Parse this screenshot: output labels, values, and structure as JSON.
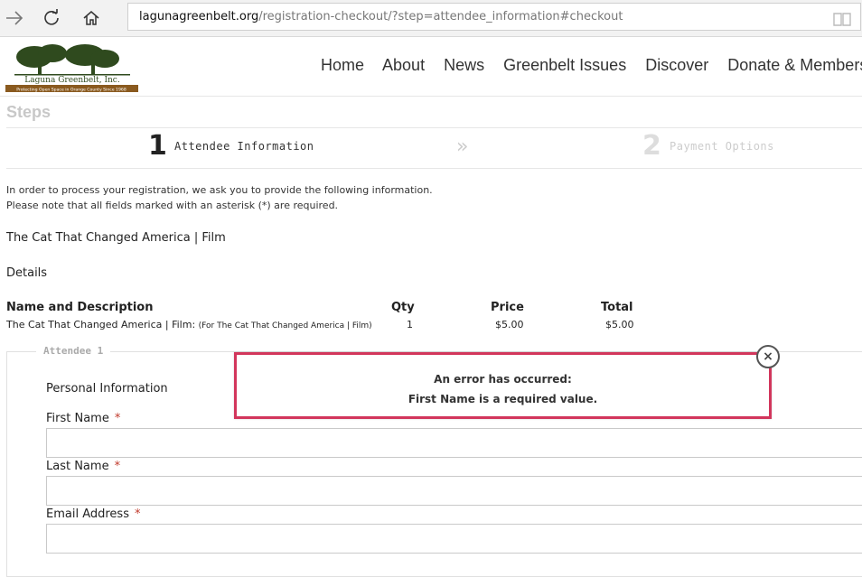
{
  "browser": {
    "url_host": "lagunagreenbelt.org",
    "url_path": "/registration-checkout/?step=attendee_information#checkout"
  },
  "site": {
    "logo_name": "Laguna Greenbelt, Inc.",
    "logo_tagline": "Protecting Open Space in Orange County Since 1968",
    "nav": [
      "Home",
      "About",
      "News",
      "Greenbelt Issues",
      "Discover",
      "Donate & Membersh"
    ]
  },
  "steps": {
    "title": "Steps",
    "step1_num": "1",
    "step1_label": "Attendee Information",
    "separator": "»",
    "step2_num": "2",
    "step2_label": "Payment Options"
  },
  "intro": {
    "line1": "In order to process your registration, we ask you to provide the following information.",
    "line2": "Please note that all fields marked with an asterisk (*) are required."
  },
  "event_title": "The Cat That Changed America | Film",
  "details_label": "Details",
  "table": {
    "headers": [
      "Name and Description",
      "Qty",
      "Price",
      "Total"
    ],
    "row": {
      "name": "The Cat That Changed America | Film: ",
      "desc": "(For The Cat That Changed America | Film)",
      "qty": "1",
      "price": "$5.00",
      "total": "$5.00"
    }
  },
  "attendee": {
    "legend": "Attendee 1",
    "section_title": "Personal Information",
    "fields": [
      {
        "label": "First Name",
        "value": ""
      },
      {
        "label": "Last Name",
        "value": ""
      },
      {
        "label": "Email Address",
        "value": ""
      }
    ],
    "required_mark": "*"
  },
  "error": {
    "title": "An error has occurred:",
    "message": "First Name is a required value.",
    "close_glyph": "×"
  },
  "colors": {
    "error_border": "#d2365c",
    "required": "#c0392b",
    "logo_green": "#2f4a1e",
    "logo_band": "#8a5a1f"
  }
}
